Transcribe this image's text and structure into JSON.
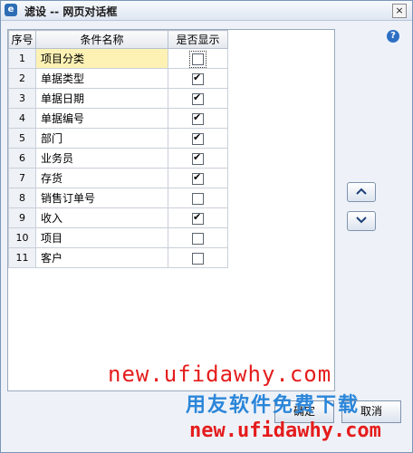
{
  "window": {
    "title": "滤设  --  网页对话框",
    "close_glyph": "×",
    "app_icon": "e"
  },
  "help_icon": "?",
  "grid": {
    "headers": [
      "序号",
      "条件名称",
      "是否显示"
    ],
    "rows": [
      {
        "no": "1",
        "name": "项目分类",
        "checked": false,
        "selected": true
      },
      {
        "no": "2",
        "name": "单据类型",
        "checked": true
      },
      {
        "no": "3",
        "name": "单据日期",
        "checked": true
      },
      {
        "no": "4",
        "name": "单据编号",
        "checked": true
      },
      {
        "no": "5",
        "name": "部门",
        "checked": true
      },
      {
        "no": "6",
        "name": "业务员",
        "checked": true
      },
      {
        "no": "7",
        "name": "存货",
        "checked": true
      },
      {
        "no": "8",
        "name": "销售订单号",
        "checked": false
      },
      {
        "no": "9",
        "name": "收入",
        "checked": true
      },
      {
        "no": "10",
        "name": "项目",
        "checked": false
      },
      {
        "no": "11",
        "name": "客户",
        "checked": false
      }
    ]
  },
  "buttons": {
    "move_up": "up-arrow",
    "move_down": "down-arrow",
    "ok": "确定",
    "cancel": "取消"
  },
  "watermark": {
    "line1": "new.ufidawhy.com",
    "line2": "用友软件免费下载",
    "line3": "new.ufidawhy.com"
  },
  "colors": {
    "selected_row": "#fdf2b4",
    "watermark_red": "#e51c1c",
    "watermark_blue": "#2b86d9"
  }
}
